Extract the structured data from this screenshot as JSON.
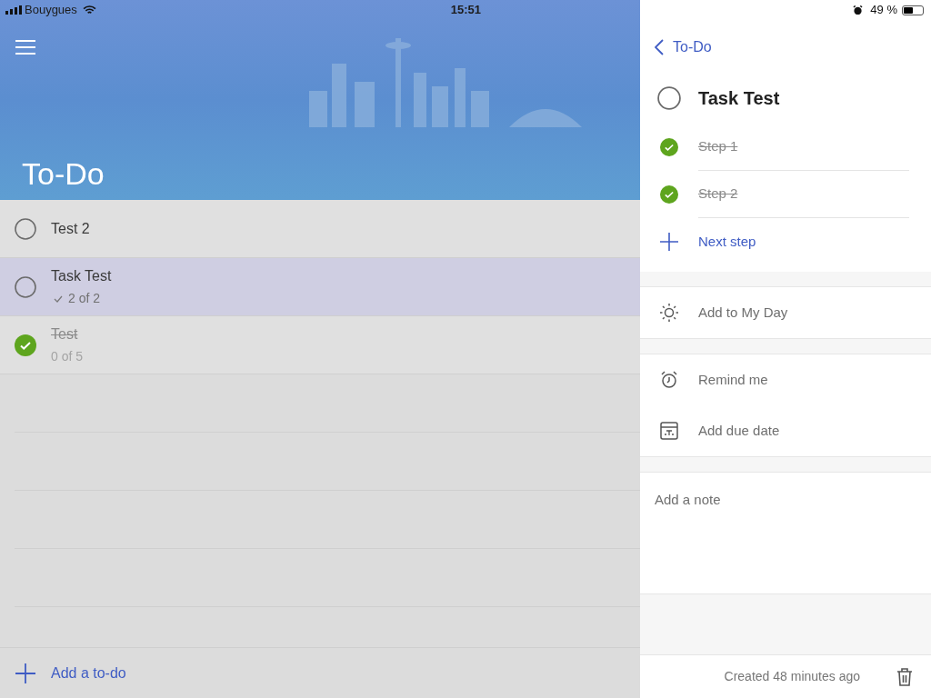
{
  "status_bar": {
    "carrier": "Bouygues",
    "time": "15:51",
    "battery": "49 %"
  },
  "list": {
    "title": "To-Do",
    "add_label": "Add a to-do",
    "tasks": [
      {
        "title": "Test 2",
        "completed": false,
        "selected": false
      },
      {
        "title": "Task Test",
        "subtitle": "2 of 2",
        "steps_done": true,
        "completed": false,
        "selected": true
      },
      {
        "title": "Test",
        "subtitle": "0 of 5",
        "steps_done": false,
        "completed": true,
        "selected": false
      }
    ]
  },
  "detail": {
    "back": "To-Do",
    "title": "Task Test",
    "completed": false,
    "steps": [
      {
        "label": "Step 1",
        "completed": true
      },
      {
        "label": "Step 2",
        "completed": true
      }
    ],
    "next_step": "Next step",
    "groups": [
      [
        {
          "kind": "sun",
          "label": "Add to My Day"
        }
      ],
      [
        {
          "kind": "alarm",
          "label": "Remind me"
        },
        {
          "kind": "calendar",
          "label": "Add due date"
        }
      ]
    ],
    "note_placeholder": "Add a note",
    "created": "Created 48 minutes ago"
  }
}
